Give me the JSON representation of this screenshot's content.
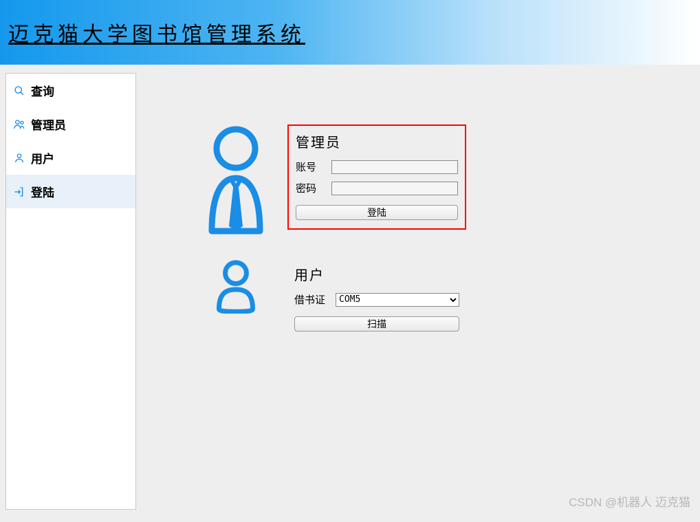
{
  "header": {
    "title": "迈克猫大学图书馆管理系统"
  },
  "sidebar": {
    "items": [
      {
        "label": "查询",
        "icon": "search-icon"
      },
      {
        "label": "管理员",
        "icon": "admin-icon"
      },
      {
        "label": "用户",
        "icon": "user-icon"
      },
      {
        "label": "登陆",
        "icon": "login-icon"
      }
    ],
    "active_index": 3
  },
  "admin_form": {
    "title": "管理员",
    "account_label": "账号",
    "account_value": "",
    "password_label": "密码",
    "password_value": "",
    "login_button": "登陆"
  },
  "user_form": {
    "title": "用户",
    "card_label": "借书证",
    "card_selected": "COM5",
    "scan_button": "扫描"
  },
  "watermark": "CSDN @机器人 迈克猫"
}
